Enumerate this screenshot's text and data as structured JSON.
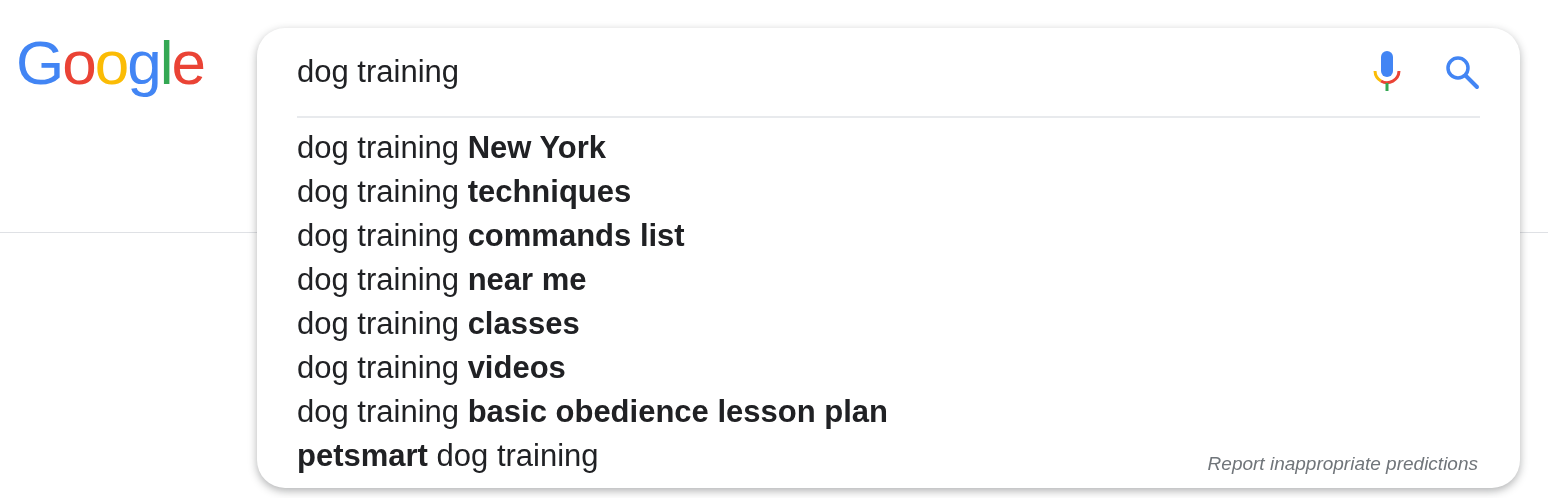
{
  "logo": "Google",
  "search": {
    "value": "dog training"
  },
  "suggestions": [
    "dog training **New York**",
    "dog training **techniques**",
    "dog training **commands list**",
    "dog training **near me**",
    "dog training **classes**",
    "dog training **videos**",
    "dog training **basic obedience lesson plan**",
    "**petsmart** dog training"
  ],
  "report_link": "Report inappropriate predictions"
}
